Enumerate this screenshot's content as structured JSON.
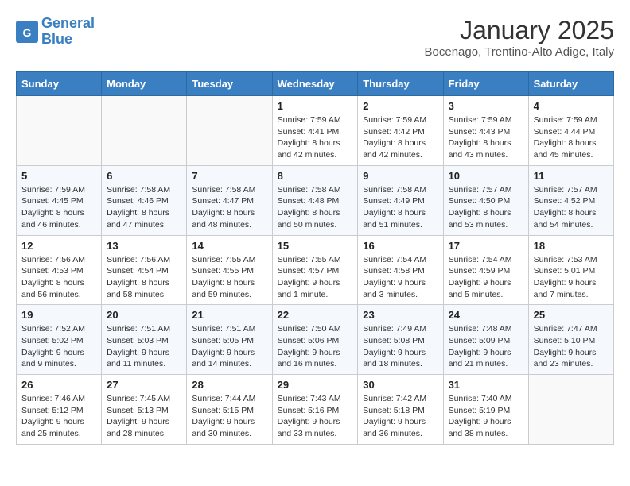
{
  "header": {
    "logo_line1": "General",
    "logo_line2": "Blue",
    "month": "January 2025",
    "location": "Bocenago, Trentino-Alto Adige, Italy"
  },
  "weekdays": [
    "Sunday",
    "Monday",
    "Tuesday",
    "Wednesday",
    "Thursday",
    "Friday",
    "Saturday"
  ],
  "weeks": [
    [
      {
        "day": "",
        "info": ""
      },
      {
        "day": "",
        "info": ""
      },
      {
        "day": "",
        "info": ""
      },
      {
        "day": "1",
        "info": "Sunrise: 7:59 AM\nSunset: 4:41 PM\nDaylight: 8 hours and 42 minutes."
      },
      {
        "day": "2",
        "info": "Sunrise: 7:59 AM\nSunset: 4:42 PM\nDaylight: 8 hours and 42 minutes."
      },
      {
        "day": "3",
        "info": "Sunrise: 7:59 AM\nSunset: 4:43 PM\nDaylight: 8 hours and 43 minutes."
      },
      {
        "day": "4",
        "info": "Sunrise: 7:59 AM\nSunset: 4:44 PM\nDaylight: 8 hours and 45 minutes."
      }
    ],
    [
      {
        "day": "5",
        "info": "Sunrise: 7:59 AM\nSunset: 4:45 PM\nDaylight: 8 hours and 46 minutes."
      },
      {
        "day": "6",
        "info": "Sunrise: 7:58 AM\nSunset: 4:46 PM\nDaylight: 8 hours and 47 minutes."
      },
      {
        "day": "7",
        "info": "Sunrise: 7:58 AM\nSunset: 4:47 PM\nDaylight: 8 hours and 48 minutes."
      },
      {
        "day": "8",
        "info": "Sunrise: 7:58 AM\nSunset: 4:48 PM\nDaylight: 8 hours and 50 minutes."
      },
      {
        "day": "9",
        "info": "Sunrise: 7:58 AM\nSunset: 4:49 PM\nDaylight: 8 hours and 51 minutes."
      },
      {
        "day": "10",
        "info": "Sunrise: 7:57 AM\nSunset: 4:50 PM\nDaylight: 8 hours and 53 minutes."
      },
      {
        "day": "11",
        "info": "Sunrise: 7:57 AM\nSunset: 4:52 PM\nDaylight: 8 hours and 54 minutes."
      }
    ],
    [
      {
        "day": "12",
        "info": "Sunrise: 7:56 AM\nSunset: 4:53 PM\nDaylight: 8 hours and 56 minutes."
      },
      {
        "day": "13",
        "info": "Sunrise: 7:56 AM\nSunset: 4:54 PM\nDaylight: 8 hours and 58 minutes."
      },
      {
        "day": "14",
        "info": "Sunrise: 7:55 AM\nSunset: 4:55 PM\nDaylight: 8 hours and 59 minutes."
      },
      {
        "day": "15",
        "info": "Sunrise: 7:55 AM\nSunset: 4:57 PM\nDaylight: 9 hours and 1 minute."
      },
      {
        "day": "16",
        "info": "Sunrise: 7:54 AM\nSunset: 4:58 PM\nDaylight: 9 hours and 3 minutes."
      },
      {
        "day": "17",
        "info": "Sunrise: 7:54 AM\nSunset: 4:59 PM\nDaylight: 9 hours and 5 minutes."
      },
      {
        "day": "18",
        "info": "Sunrise: 7:53 AM\nSunset: 5:01 PM\nDaylight: 9 hours and 7 minutes."
      }
    ],
    [
      {
        "day": "19",
        "info": "Sunrise: 7:52 AM\nSunset: 5:02 PM\nDaylight: 9 hours and 9 minutes."
      },
      {
        "day": "20",
        "info": "Sunrise: 7:51 AM\nSunset: 5:03 PM\nDaylight: 9 hours and 11 minutes."
      },
      {
        "day": "21",
        "info": "Sunrise: 7:51 AM\nSunset: 5:05 PM\nDaylight: 9 hours and 14 minutes."
      },
      {
        "day": "22",
        "info": "Sunrise: 7:50 AM\nSunset: 5:06 PM\nDaylight: 9 hours and 16 minutes."
      },
      {
        "day": "23",
        "info": "Sunrise: 7:49 AM\nSunset: 5:08 PM\nDaylight: 9 hours and 18 minutes."
      },
      {
        "day": "24",
        "info": "Sunrise: 7:48 AM\nSunset: 5:09 PM\nDaylight: 9 hours and 21 minutes."
      },
      {
        "day": "25",
        "info": "Sunrise: 7:47 AM\nSunset: 5:10 PM\nDaylight: 9 hours and 23 minutes."
      }
    ],
    [
      {
        "day": "26",
        "info": "Sunrise: 7:46 AM\nSunset: 5:12 PM\nDaylight: 9 hours and 25 minutes."
      },
      {
        "day": "27",
        "info": "Sunrise: 7:45 AM\nSunset: 5:13 PM\nDaylight: 9 hours and 28 minutes."
      },
      {
        "day": "28",
        "info": "Sunrise: 7:44 AM\nSunset: 5:15 PM\nDaylight: 9 hours and 30 minutes."
      },
      {
        "day": "29",
        "info": "Sunrise: 7:43 AM\nSunset: 5:16 PM\nDaylight: 9 hours and 33 minutes."
      },
      {
        "day": "30",
        "info": "Sunrise: 7:42 AM\nSunset: 5:18 PM\nDaylight: 9 hours and 36 minutes."
      },
      {
        "day": "31",
        "info": "Sunrise: 7:40 AM\nSunset: 5:19 PM\nDaylight: 9 hours and 38 minutes."
      },
      {
        "day": "",
        "info": ""
      }
    ]
  ]
}
